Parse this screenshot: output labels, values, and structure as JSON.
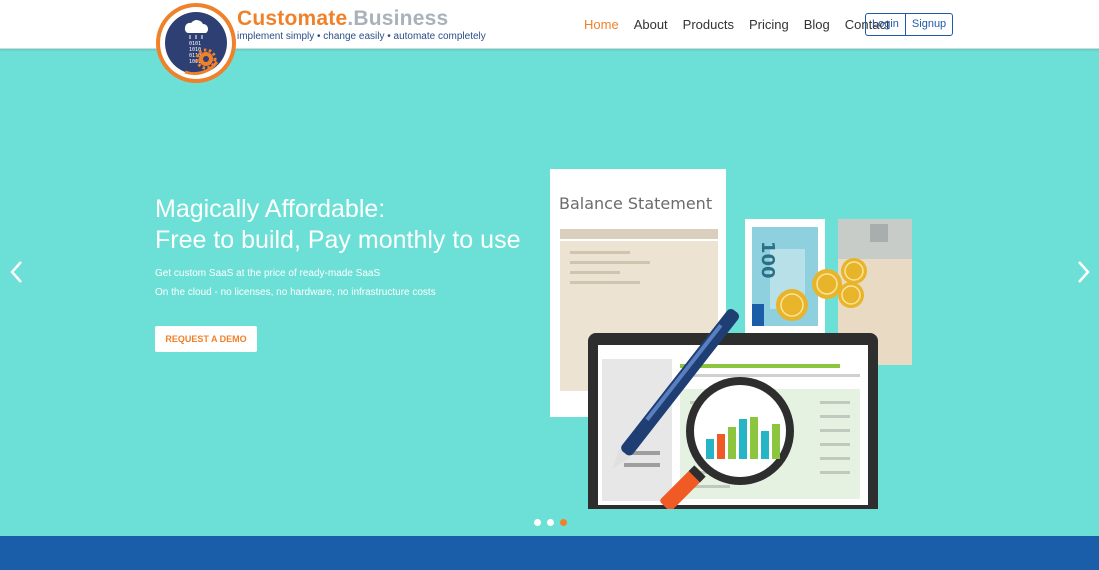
{
  "brand": {
    "name_part1": "Customate",
    "name_part2": ".Business",
    "tagline": "implement simply • change easily • automate completely",
    "colors": {
      "orange": "#f0812b",
      "grey": "#a9b2bb",
      "navy": "#2a4e8a"
    },
    "logo_icon": "cloud-binary-gear-logo"
  },
  "nav": {
    "items": [
      {
        "label": "Home",
        "active": true
      },
      {
        "label": "About",
        "active": false
      },
      {
        "label": "Products",
        "active": false
      },
      {
        "label": "Pricing",
        "active": false
      },
      {
        "label": "Blog",
        "active": false
      },
      {
        "label": "Contact",
        "active": false
      }
    ],
    "login_label": "Login",
    "signup_label": "Signup"
  },
  "hero": {
    "headline_line1": "Magically Affordable:",
    "headline_line2": "Free to build, Pay monthly to use",
    "sub_line1": "Get custom SaaS at the price of ready-made SaaS",
    "sub_line2": "On the cloud - no licenses, no hardware, no infrastructure costs",
    "cta_label": "REQUEST A DEMO",
    "background_color": "#6ce0d7",
    "illustration": {
      "document_title": "Balance Statement",
      "banknote_value": "100"
    },
    "carousel": {
      "slide_count": 3,
      "active_index": 2
    }
  },
  "footer_band_color": "#1a5ea9"
}
